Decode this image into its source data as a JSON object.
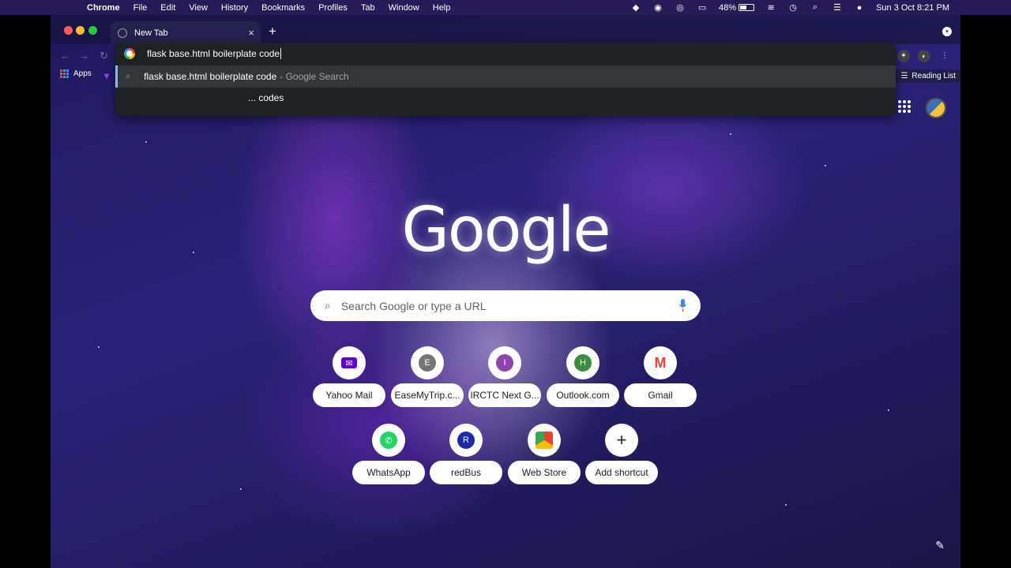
{
  "menubar": {
    "app_name": "Chrome",
    "items": [
      "File",
      "Edit",
      "View",
      "History",
      "Bookmarks",
      "Profiles",
      "Tab",
      "Window",
      "Help"
    ],
    "battery_percent": "48%",
    "battery_level": 0.48,
    "datetime": "Sun 3 Oct  8:21 PM"
  },
  "browser": {
    "tab_title": "New Tab",
    "bookmarks_bar": {
      "apps_label": "Apps",
      "reading_list_label": "Reading List"
    },
    "omnibox": {
      "input_text": "flask base.html boilerplate code",
      "suggestion_text": "flask base.html boilerplate code",
      "suggestion_hint": "- Google Search",
      "sub_suggestion": "... codes"
    }
  },
  "ntp": {
    "logo_text": "Google",
    "search_placeholder": "Search Google or type a URL",
    "shortcuts": [
      {
        "label": "Yahoo Mail",
        "icon": "mail-icon",
        "color": "#6001d2"
      },
      {
        "label": "EaseMyTrip.c...",
        "icon": "letter-E",
        "letter": "E",
        "color": "#757575"
      },
      {
        "label": "IRCTC Next G...",
        "icon": "letter-I",
        "letter": "I",
        "color": "#8e44ad"
      },
      {
        "label": "Outlook.com",
        "icon": "letter-H",
        "letter": "H",
        "color": "#388e3c"
      },
      {
        "label": "Gmail",
        "icon": "gmail-icon",
        "color": "#ea4335"
      },
      {
        "label": "WhatsApp",
        "icon": "whatsapp-icon",
        "color": "#25d366"
      },
      {
        "label": "redBus",
        "icon": "letter-R",
        "letter": "R",
        "color": "#1a2aa8"
      },
      {
        "label": "Web Store",
        "icon": "webstore-icon",
        "color": "#4285f4"
      },
      {
        "label": "Add shortcut",
        "icon": "plus-icon",
        "color": "#202124"
      }
    ]
  }
}
